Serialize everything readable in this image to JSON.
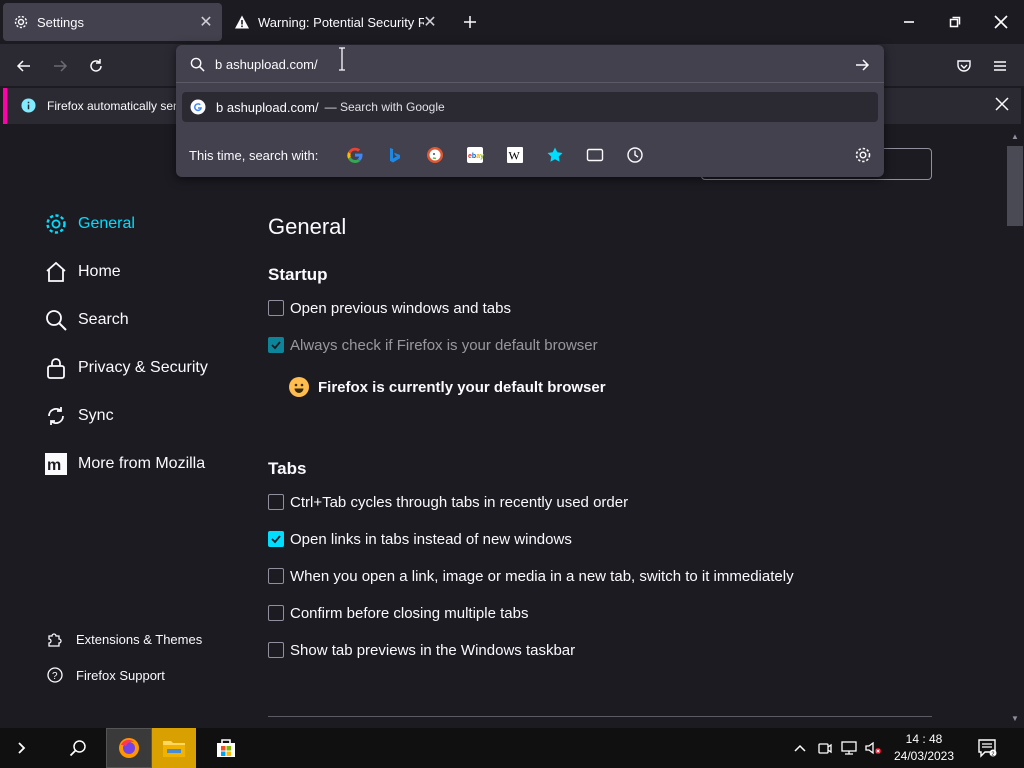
{
  "tabs": [
    {
      "title": "Settings",
      "icon": "gear-icon",
      "active": true
    },
    {
      "title": "Warning: Potential Security Risk",
      "icon": "warning-icon",
      "active": false
    }
  ],
  "urlbar": {
    "value": "b ashupload.com/",
    "suggestion_text": "b ashupload.com/",
    "suggestion_action": "— Search with Google",
    "search_with_label": "This time, search with:",
    "engines": [
      "google-icon",
      "bing-icon",
      "duckduckgo-icon",
      "ebay-icon",
      "wikipedia-icon",
      "bookmarks-star-icon",
      "tabs-icon",
      "history-icon"
    ]
  },
  "notification": {
    "text": "Firefox automatically sen"
  },
  "sidebar": {
    "items": [
      {
        "label": "General",
        "icon": "gear-icon"
      },
      {
        "label": "Home",
        "icon": "home-icon"
      },
      {
        "label": "Search",
        "icon": "search-icon"
      },
      {
        "label": "Privacy & Security",
        "icon": "lock-icon"
      },
      {
        "label": "Sync",
        "icon": "sync-icon"
      },
      {
        "label": "More from Mozilla",
        "icon": "mozilla-icon"
      }
    ],
    "footer": [
      {
        "label": "Extensions & Themes",
        "icon": "puzzle-icon"
      },
      {
        "label": "Firefox Support",
        "icon": "help-icon"
      }
    ]
  },
  "main": {
    "title": "General",
    "startup": {
      "heading": "Startup",
      "options": [
        {
          "label": "Open previous windows and tabs",
          "checked": false
        },
        {
          "label": "Always check if Firefox is your default browser",
          "checked": true,
          "disabled": true
        }
      ],
      "default_message": "Firefox is currently your default browser"
    },
    "tabs": {
      "heading": "Tabs",
      "options": [
        {
          "label": "Ctrl+Tab cycles through tabs in recently used order",
          "checked": false
        },
        {
          "label": "Open links in tabs instead of new windows",
          "checked": true
        },
        {
          "label": "When you open a link, image or media in a new tab, switch to it immediately",
          "checked": false
        },
        {
          "label": "Confirm before closing multiple tabs",
          "checked": false
        },
        {
          "label": "Show tab previews in the Windows taskbar",
          "checked": false
        }
      ]
    }
  },
  "taskbar": {
    "time": "14 : 48",
    "date": "24/03/2023"
  },
  "colors": {
    "accent": "#00ddff",
    "background": "#1c1b22",
    "toolbar": "#2b2a33",
    "popup": "#42414d",
    "notification_stripe": "#ff00aa"
  }
}
